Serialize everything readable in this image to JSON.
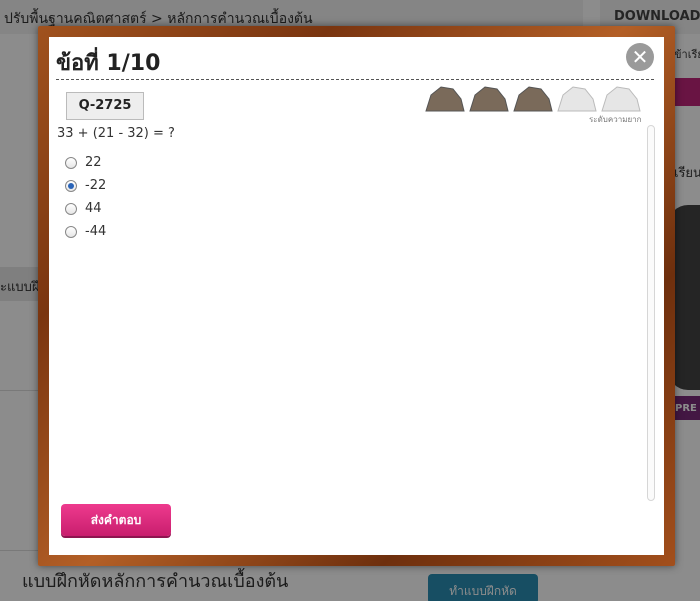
{
  "background": {
    "breadcrumb": "ปรับพื้นฐานคณิตศาสตร์ > หลักการคำนวณเบื้องต้น",
    "download_label": "DOWNLOAD",
    "section_fragment": "ะแบบฝึ",
    "bottom_title": "แบบฝึกหัดหลักการคำนวณเบื้องต้น",
    "bottom_button": "ทำแบบฝึกหัด",
    "side_fragment": "ข้าเรีย",
    "side_fragment2": "เรียน",
    "side_pre": "PRE"
  },
  "modal": {
    "title": "ข้อที่ 1/10",
    "question_id": "Q-2725",
    "question": "33 + (21 - 32) = ?",
    "difficulty_label": "ระดับความยาก",
    "difficulty": {
      "level": 3,
      "max": 5,
      "filled_color": "#7a6a5a",
      "empty_color": "#e6e6e6"
    },
    "choices": [
      {
        "label": "22",
        "checked": false
      },
      {
        "label": "-22",
        "checked": true
      },
      {
        "label": "44",
        "checked": false
      },
      {
        "label": "-44",
        "checked": false
      }
    ],
    "submit_label": "ส่งคำตอบ",
    "close_icon": "close-icon"
  },
  "colors": {
    "submit": "#e0287f",
    "frame": "#8b4513"
  }
}
